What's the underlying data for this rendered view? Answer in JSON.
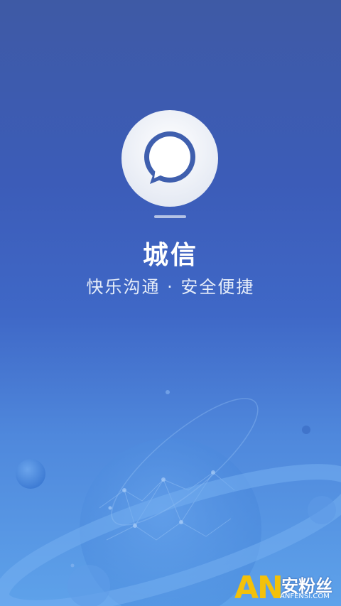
{
  "splash": {
    "app_name": "城信",
    "slogan": "快乐沟通 · 安全便捷"
  },
  "watermark": {
    "letters": "AN",
    "site_name_cn": "安粉丝",
    "site_url": "ANFENSI.COM"
  },
  "colors": {
    "accent": "#3c5cb8",
    "logo_bubble": "#3f5fae",
    "watermark_gold": "#f3c10a"
  }
}
